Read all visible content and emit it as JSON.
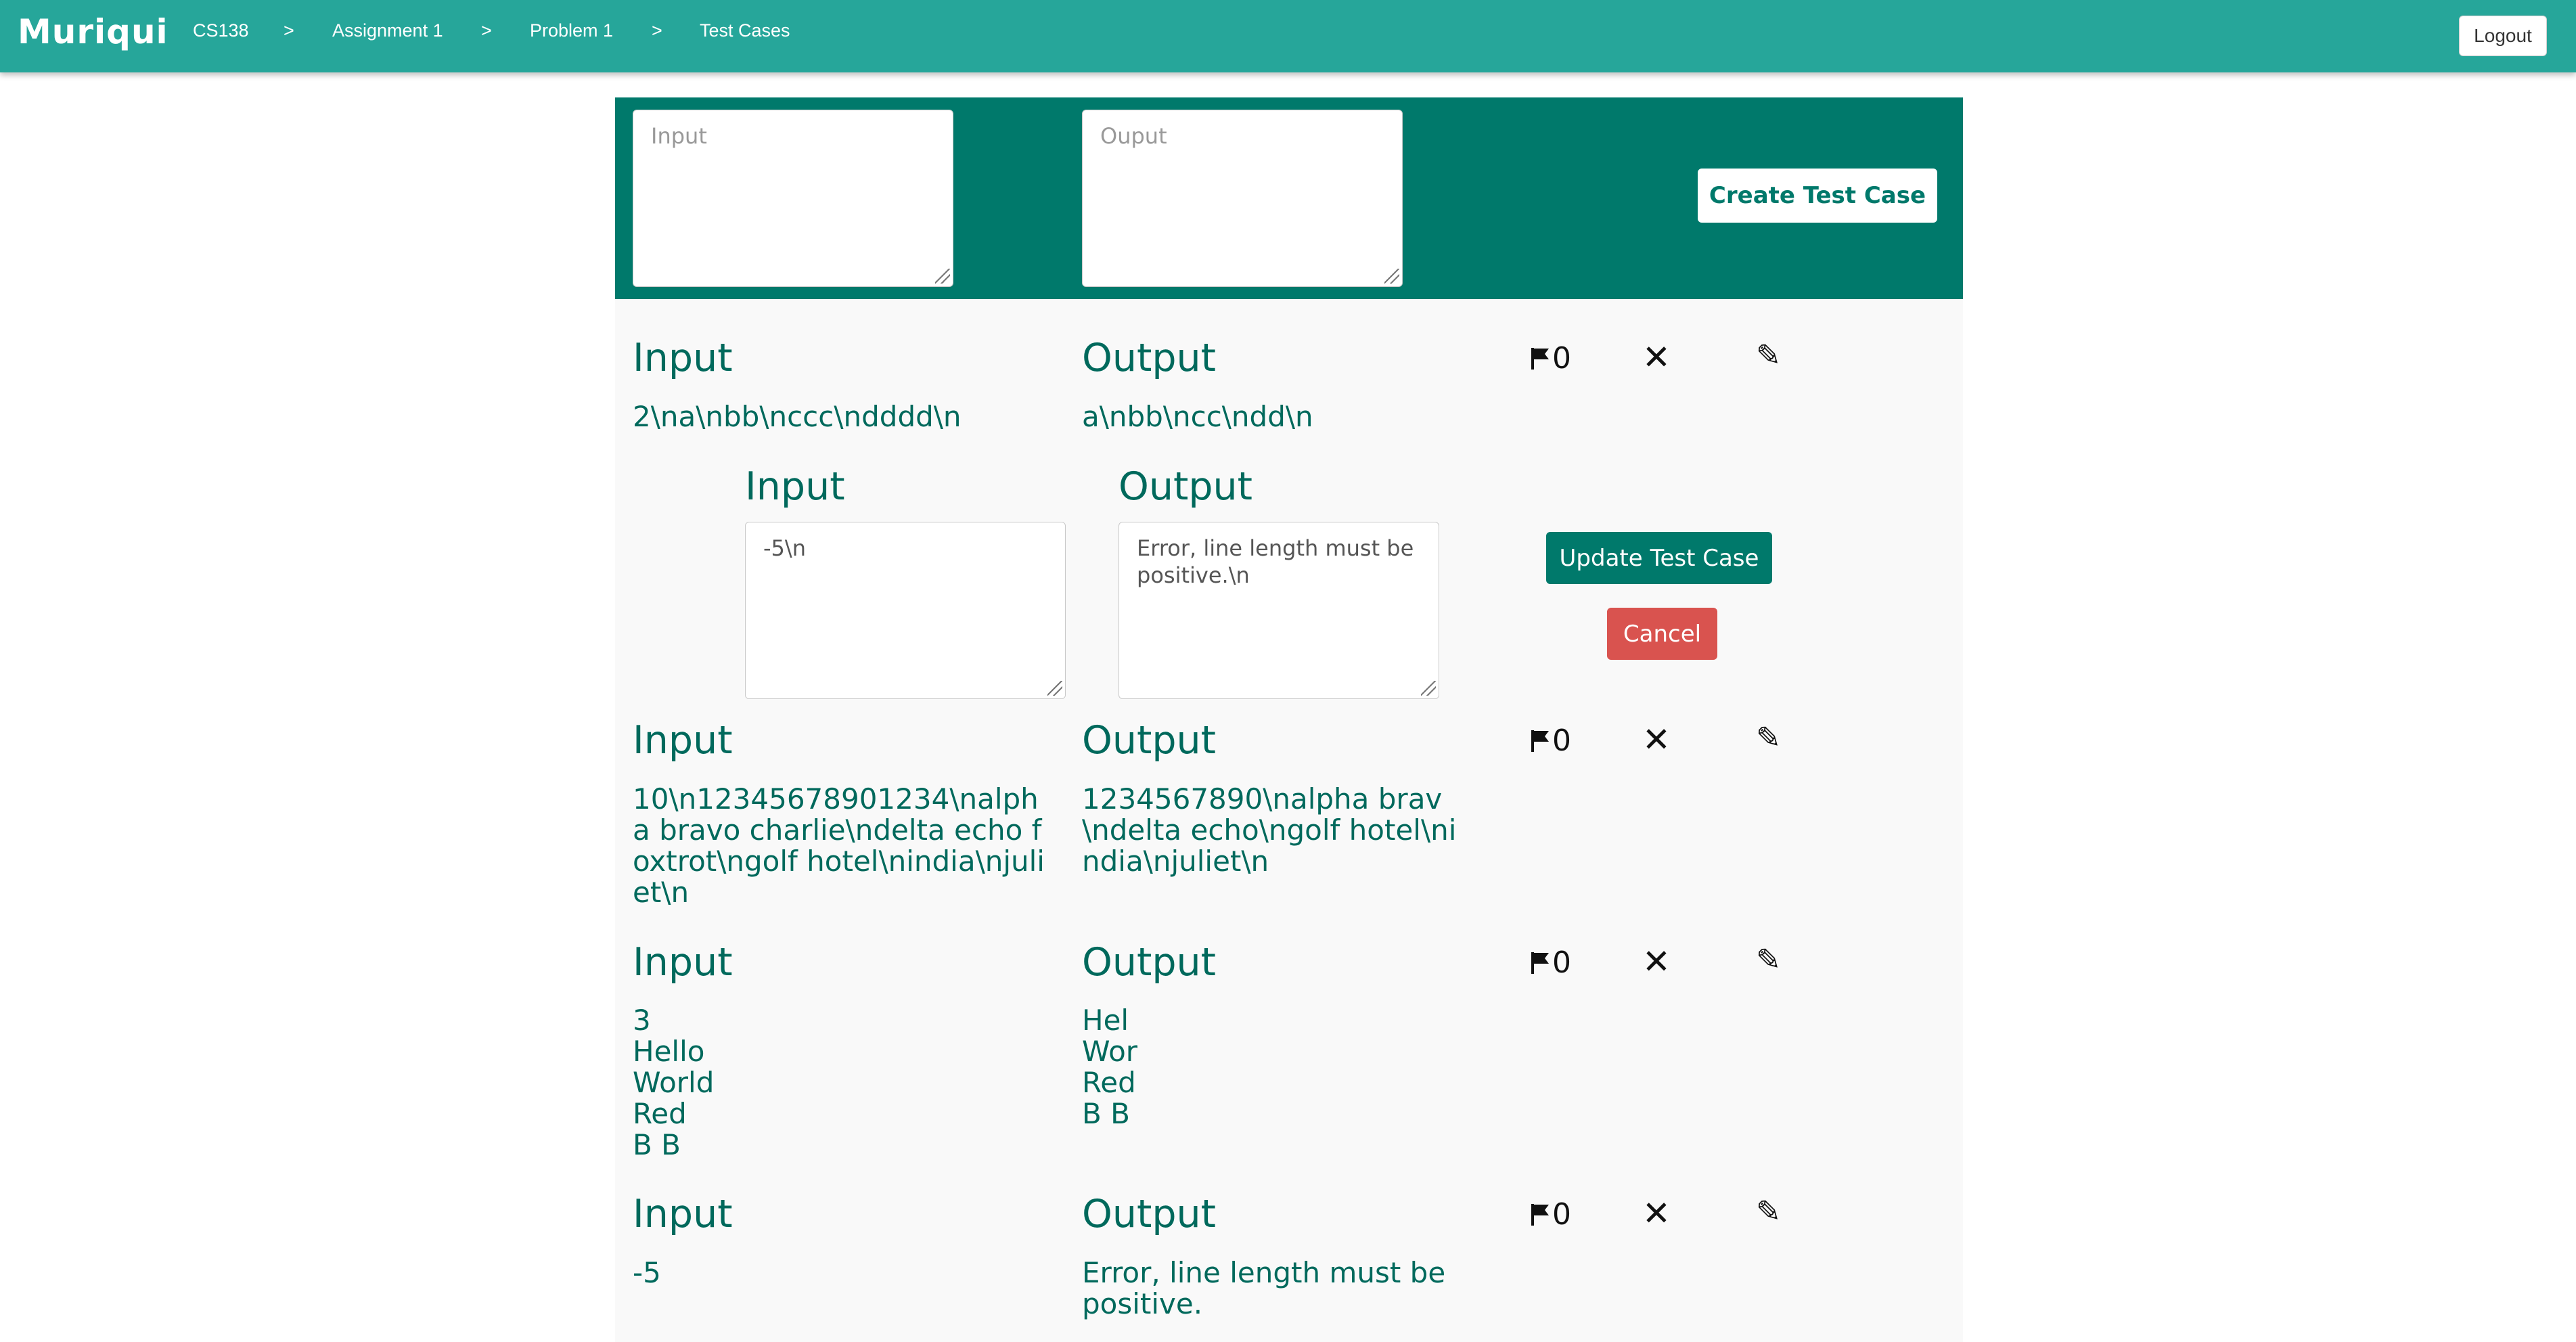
{
  "navbar": {
    "brand": "Muriqui",
    "breadcrumbs": [
      "CS138",
      "Assignment 1",
      "Problem 1",
      "Test Cases"
    ],
    "separator": ">",
    "logout_label": "Logout"
  },
  "create_form": {
    "input_placeholder": "Input",
    "output_placeholder": "Ouput",
    "create_label": "Create Test Case"
  },
  "labels": {
    "input": "Input",
    "output": "Output"
  },
  "edit_form": {
    "input_value": "-5\\n",
    "output_value": "Error, line length must be positive.\\n",
    "update_label": "Update Test Case",
    "cancel_label": "Cancel"
  },
  "test_cases": [
    {
      "input": "2\\na\\nbb\\nccc\\ndddd\\n",
      "output": "a\\nbb\\ncc\\ndd\\n",
      "flags": "0"
    },
    {
      "input": "10\\n12345678901234\\nalpha bravo charlie\\ndelta echo foxtrot\\ngolf hotel\\nindia\\njuliet\\n",
      "output": "1234567890\\nalpha brav\\ndelta echo\\ngolf hotel\\nindia\\njuliet\\n",
      "flags": "0"
    },
    {
      "input": "3\nHello\nWorld\nRed\nB B",
      "output": "Hel\nWor\nRed\nB B",
      "flags": "0"
    },
    {
      "input": "-5",
      "output": "Error, line length must be positive.",
      "flags": "0"
    }
  ],
  "icons": {
    "flag": "flag-icon",
    "delete": "close-icon",
    "edit": "pencil-icon"
  },
  "colors": {
    "navbar": "#26a69a",
    "panel": "#00796b",
    "danger": "#d9534f"
  }
}
